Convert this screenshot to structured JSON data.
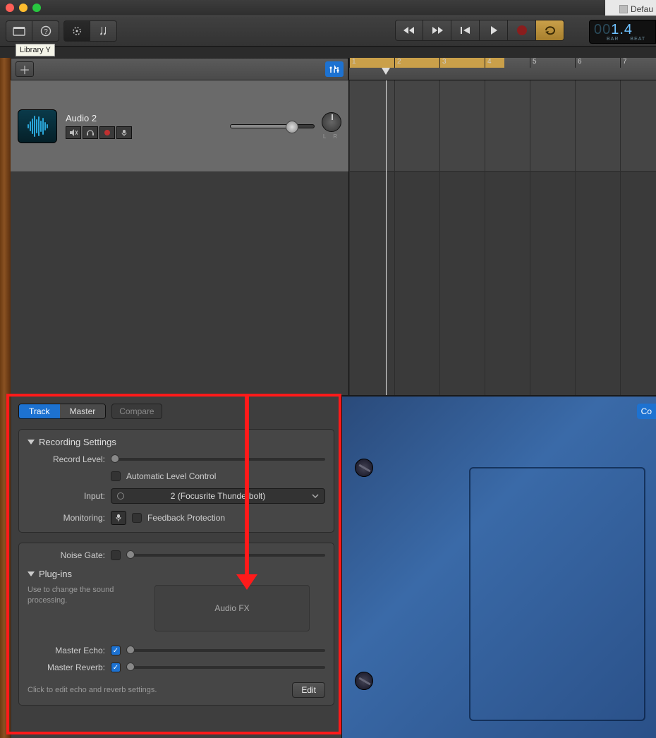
{
  "titlebar": {
    "doc_label": "Defau"
  },
  "tooltip": {
    "library": "Library   Y"
  },
  "lcd": {
    "value_dim": "00",
    "value": "1.4",
    "label_bar": "BAR",
    "label_beat": "BEAT"
  },
  "ruler": {
    "bars": [
      "1",
      "2",
      "3",
      "4",
      "5",
      "6",
      "7"
    ]
  },
  "track": {
    "name": "Audio 2",
    "pan_labels": "L    R"
  },
  "inspector": {
    "tabs": {
      "track": "Track",
      "master": "Master"
    },
    "compare": "Compare",
    "co": "Co",
    "recording": {
      "title": "Recording Settings",
      "record_level": "Record Level:",
      "auto_level": "Automatic Level Control",
      "input_label": "Input:",
      "input_value": "2  (Focusrite Thunderbolt)",
      "monitoring": "Monitoring:",
      "feedback": "Feedback Protection"
    },
    "noise_gate": "Noise Gate:",
    "plugins": {
      "title": "Plug-ins",
      "hint": "Use to change the sound processing.",
      "slot": "Audio FX"
    },
    "master_echo": "Master Echo:",
    "master_reverb": "Master Reverb:",
    "foot_hint": "Click to edit echo and reverb settings.",
    "edit": "Edit"
  }
}
